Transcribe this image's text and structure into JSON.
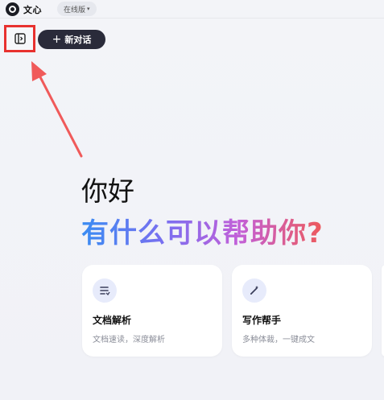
{
  "app": {
    "name": "文心",
    "version_selector": "在线版"
  },
  "toolbar": {
    "new_chat_label": "新对话",
    "sidebar_toggle_icon": "sidebar-expand-icon"
  },
  "hero": {
    "greeting": "你好",
    "headline": "有什么可以帮助你?"
  },
  "cards": [
    {
      "title": "文档解析",
      "subtitle": "文档速读，深度解析",
      "icon": "document-list-icon"
    },
    {
      "title": "写作帮手",
      "subtitle": "多种体裁，一键成文",
      "icon": "pen-sparkle-icon"
    }
  ],
  "colors": {
    "highlight_border": "#e8312f",
    "arrow": "#f05a5a",
    "new_chat_bg": "#2a2b3a",
    "headline_gradient": [
      "#3a8cf2",
      "#7b6ef0",
      "#c260d8",
      "#ee5a5a"
    ]
  }
}
